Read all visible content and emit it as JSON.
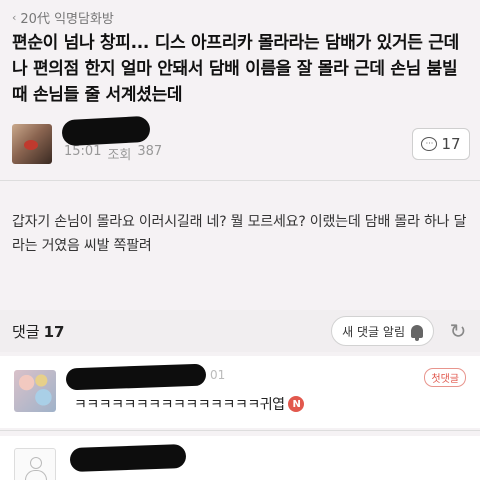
{
  "board": {
    "name": "20代 익명담화방",
    "chevron": "‹"
  },
  "post": {
    "title": "편순이 넘나 창피... 디스 아프리카 몰라라는 담배가 있거든 근데 나 편의점 한지 얼마 안돼서 담배 이름을 잘 몰라 근데 손님 붐빌때 손님들 줄 서계셨는데",
    "time": "15:01",
    "views_label": "조회",
    "views": "387",
    "comment_count": "17",
    "body": "갑자기 손님이 몰라요 이러시길래 네? 뭘 모르세요? 이랬는데 담배 몰라 하나 달라는 거였음 씨발 쪽팔려"
  },
  "comments_bar": {
    "label": "댓글",
    "count": "17",
    "notify_label": "새 댓글 알림"
  },
  "comments": [
    {
      "time": "01",
      "text": "ㅋㅋㅋㅋㅋㅋㅋㅋㅋㅋㅋㅋㅋㅋㅋ귀엽",
      "badge": "첫댓글",
      "new_badge": "N"
    }
  ],
  "colors": {
    "accent": "#e2584d",
    "background": "#f5f2f4",
    "redaction": "#0d0d0d"
  },
  "icons": [
    "chevron-left-icon",
    "comment-bubble-icon",
    "bell-icon",
    "refresh-icon",
    "person-icon"
  ]
}
